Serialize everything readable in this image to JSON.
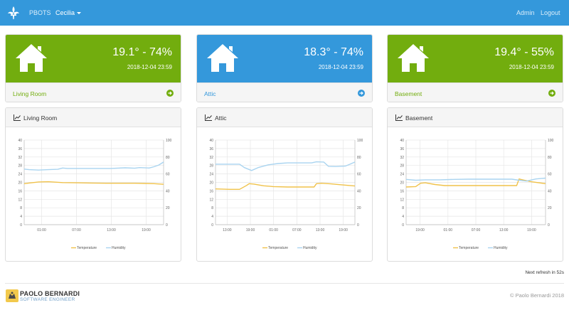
{
  "nav": {
    "brand": "PBOTS",
    "user": "Cecilia",
    "admin": "Admin",
    "logout": "Logout"
  },
  "colors": {
    "navbar": "#3498db",
    "card_green": "#72ad0e",
    "card_blue": "#3498db",
    "temperature_line": "#f0c24a",
    "humidity_line": "#a9d4f0"
  },
  "cards": [
    {
      "reading": "19.1°  -  74%",
      "timestamp": "2018-12-04 23:59",
      "label": "Living Room",
      "color": "green",
      "icon": "house-icon"
    },
    {
      "reading": "18.3°  -  74%",
      "timestamp": "2018-12-04 23:59",
      "label": "Attic",
      "color": "blue",
      "icon": "house-icon"
    },
    {
      "reading": "19.4°  -  55%",
      "timestamp": "2018-12-04 23:59",
      "label": "Basement",
      "color": "green",
      "icon": "house-icon"
    }
  ],
  "panels": [
    {
      "title": "Living Room"
    },
    {
      "title": "Attic"
    },
    {
      "title": "Basement"
    }
  ],
  "chart_data": [
    {
      "type": "line",
      "title": "Living Room",
      "x_ticks": [
        "01:00",
        "07:00",
        "13:00",
        "19:00"
      ],
      "x_range": [
        0,
        29
      ],
      "y_left_ticks": [
        0,
        4,
        8,
        12,
        16,
        20,
        24,
        28,
        32,
        36,
        40
      ],
      "y_right_ticks": [
        0,
        20,
        40,
        60,
        80,
        100
      ],
      "ylim_left": [
        0,
        40
      ],
      "ylim_right": [
        0,
        100
      ],
      "legend": [
        "Temperature",
        "Humidity"
      ],
      "legend_position": "bottom",
      "grid": true,
      "series": [
        {
          "name": "Temperature",
          "axis": "left",
          "x": [
            0,
            1,
            3,
            5,
            8,
            11,
            14,
            17,
            20,
            23,
            25,
            27,
            29
          ],
          "y": [
            19.4,
            19.7,
            20.2,
            20.3,
            19.9,
            19.8,
            19.7,
            19.6,
            19.6,
            19.6,
            19.5,
            19.4,
            19.1
          ]
        },
        {
          "name": "Humidity",
          "axis": "left",
          "x": [
            0,
            1,
            3,
            5,
            7,
            8,
            9,
            12,
            15,
            18,
            21,
            23,
            24,
            26,
            27,
            28,
            29
          ],
          "y": [
            26.3,
            26.0,
            25.8,
            26.0,
            26.2,
            26.8,
            26.6,
            26.6,
            26.6,
            26.6,
            26.9,
            26.7,
            27.0,
            26.8,
            27.4,
            28.2,
            29.6
          ]
        }
      ]
    },
    {
      "type": "line",
      "title": "Attic",
      "x_ticks": [
        "13:00",
        "19:00",
        "01:00",
        "07:00",
        "13:00",
        "19:00"
      ],
      "x_range": [
        0,
        29
      ],
      "y_left_ticks": [
        0,
        4,
        8,
        12,
        16,
        20,
        24,
        28,
        32,
        36,
        40
      ],
      "y_right_ticks": [
        0,
        20,
        40,
        60,
        80,
        100
      ],
      "ylim_left": [
        0,
        40
      ],
      "ylim_right": [
        0,
        100
      ],
      "legend": [
        "Temperature",
        "Humidity"
      ],
      "legend_position": "bottom",
      "grid": true,
      "series": [
        {
          "name": "Temperature",
          "axis": "left",
          "x": [
            0,
            3,
            5,
            6.5,
            7,
            8,
            10,
            12,
            15,
            18,
            20.5,
            21,
            22,
            24,
            26,
            29
          ],
          "y": [
            16.9,
            16.7,
            16.7,
            18.6,
            19.4,
            19.2,
            18.4,
            18.0,
            17.8,
            17.8,
            17.8,
            19.4,
            19.6,
            19.3,
            18.9,
            18.3
          ]
        },
        {
          "name": "Humidity",
          "axis": "left",
          "x": [
            0,
            2,
            5,
            6,
            7.5,
            9,
            11,
            13,
            15,
            17,
            20,
            21,
            22.5,
            23.5,
            25,
            27,
            28,
            29
          ],
          "y": [
            28.6,
            28.6,
            28.6,
            27.0,
            25.6,
            27.1,
            28.3,
            28.9,
            29.2,
            29.2,
            29.2,
            29.7,
            29.6,
            27.6,
            27.5,
            27.7,
            28.6,
            29.6
          ]
        }
      ]
    },
    {
      "type": "line",
      "title": "Basement",
      "x_ticks": [
        "19:00",
        "01:00",
        "07:00",
        "13:00",
        "19:00"
      ],
      "x_range": [
        0,
        29
      ],
      "y_left_ticks": [
        0,
        4,
        8,
        12,
        16,
        20,
        24,
        28,
        32,
        36,
        40
      ],
      "y_right_ticks": [
        0,
        20,
        40,
        60,
        80,
        100
      ],
      "ylim_left": [
        0,
        40
      ],
      "ylim_right": [
        0,
        100
      ],
      "legend": [
        "Temperature",
        "Humidity"
      ],
      "legend_position": "bottom",
      "grid": true,
      "series": [
        {
          "name": "Temperature",
          "axis": "left",
          "x": [
            0,
            2,
            3,
            4,
            6,
            8,
            11,
            14,
            17,
            20,
            23,
            23.5,
            24,
            26,
            29
          ],
          "y": [
            17.8,
            18.0,
            19.6,
            19.8,
            19.0,
            18.5,
            18.5,
            18.5,
            18.5,
            18.5,
            18.5,
            21.6,
            21.3,
            20.3,
            19.4
          ]
        },
        {
          "name": "Humidity",
          "axis": "left",
          "x": [
            0,
            2,
            4,
            7,
            10,
            13,
            16,
            19,
            22,
            23.5,
            25,
            27,
            29
          ],
          "y": [
            21.4,
            21.0,
            21.2,
            21.2,
            21.4,
            21.5,
            21.5,
            21.5,
            21.5,
            21.0,
            20.6,
            21.6,
            22.0
          ]
        }
      ]
    }
  ],
  "refresh_text": "Next refresh in 52s",
  "footer": {
    "name": "PAOLO BERNARDI",
    "subtitle": "SOFTWARE ENGINEER",
    "copyright": "© Paolo Bernardi  2018"
  }
}
